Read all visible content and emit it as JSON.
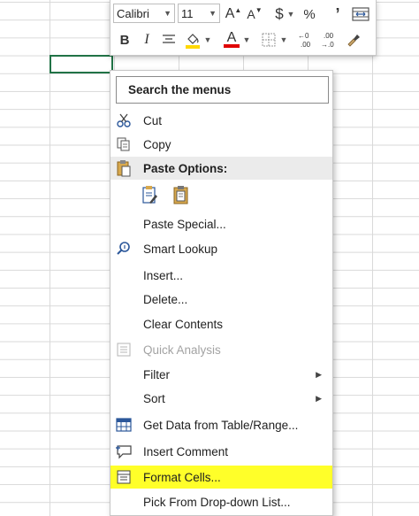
{
  "toolbar": {
    "font_name": "Calibri",
    "font_size": "11",
    "increase_font": "A",
    "decrease_font": "A",
    "currency": "$",
    "percent": "%",
    "comma": "’",
    "bold": "B",
    "italic": "I",
    "font_color_letter": "A",
    "increase_decimal": "⁰0",
    "decrease_decimal": ".00"
  },
  "menu": {
    "search_placeholder": "Search the menus",
    "cut": "Cut",
    "copy": "Copy",
    "paste_options": "Paste Options:",
    "paste_special": "Paste Special...",
    "smart_lookup": "Smart Lookup",
    "insert": "Insert...",
    "delete": "Delete...",
    "clear_contents": "Clear Contents",
    "quick_analysis": "Quick Analysis",
    "filter": "Filter",
    "sort": "Sort",
    "get_data": "Get Data from Table/Range...",
    "insert_comment": "Insert Comment",
    "format_cells": "Format Cells...",
    "pick_from_list": "Pick From Drop-down List..."
  },
  "colors": {
    "highlight": "#ffff29",
    "fill_color": "#ffd800",
    "font_color": "#e00000",
    "active_cell_border": "#217346"
  }
}
